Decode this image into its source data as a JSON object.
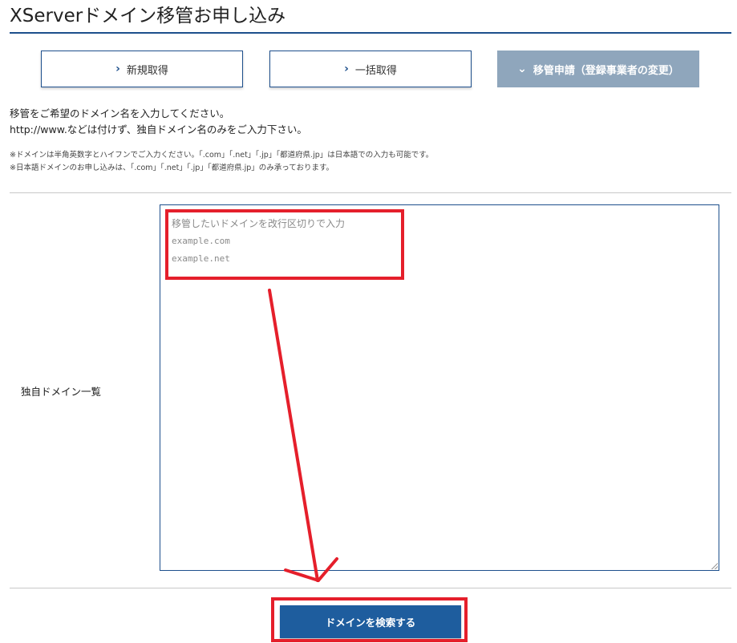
{
  "header": {
    "title": "XServerドメイン移管お申し込み"
  },
  "tabs": [
    {
      "label": "新規取得",
      "icon": "chevron-right-icon",
      "active": false
    },
    {
      "label": "一括取得",
      "icon": "chevron-right-icon",
      "active": false
    },
    {
      "label": "移管申請（登録事業者の変更）",
      "icon": "chevron-down-icon",
      "active": true
    }
  ],
  "intro": {
    "line1": "移管をご希望のドメイン名を入力してください。",
    "line2": "http://www.などは付けず、独自ドメイン名のみをご入力下さい。"
  },
  "notes": {
    "line1": "※ドメインは半角英数字とハイフンでご入力ください。「.com」「.net」「.jp」「都道府県.jp」は日本語での入力も可能です。",
    "line2": "※日本語ドメインのお申し込みは、「.com」「.net」「.jp」「都道府県.jp」のみ承っております。"
  },
  "form": {
    "label": "独自ドメイン一覧",
    "placeholder_line1": "移管したいドメインを改行区切りで入力",
    "placeholder_line2": "example.com",
    "placeholder_line3": "example.net",
    "submit_label": "ドメインを検索する"
  },
  "colors": {
    "brand": "#1d4f8c",
    "button": "#1e5d9e",
    "active_tab": "#8fa6bc",
    "annotation": "#e51f2b"
  }
}
